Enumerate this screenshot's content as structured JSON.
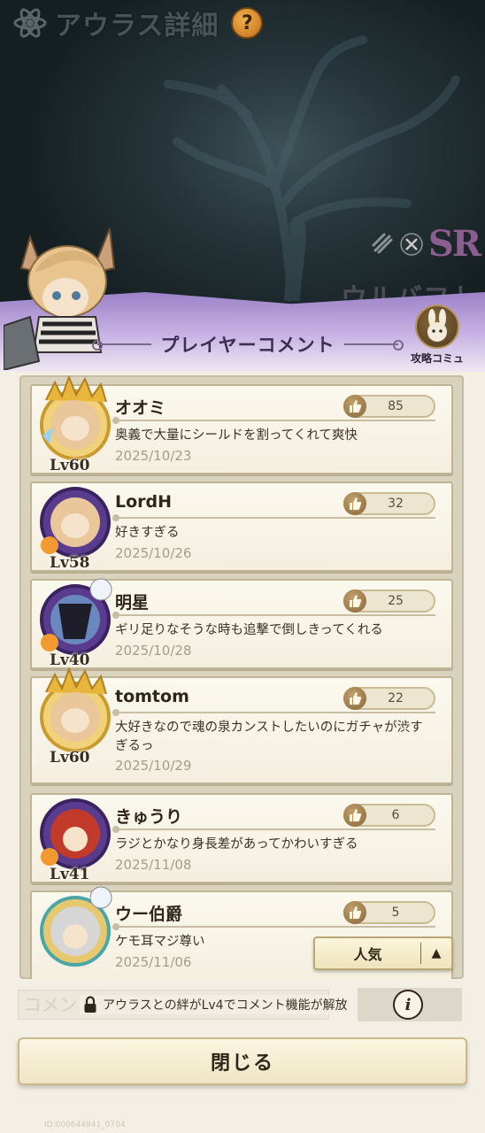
{
  "header": {
    "title": "アウラス詳細",
    "help_label": "?",
    "logo_icon": "atom-emblem-icon"
  },
  "character": {
    "rarity": "SR",
    "name": "ウルバフト",
    "attribute_icons": [
      "wind-attribute-icon",
      "blade-class-icon"
    ]
  },
  "section": {
    "title": "プレイヤーコメント",
    "wiki_label": "攻略コミュ"
  },
  "comments": [
    {
      "name": "オオミ",
      "level": "Lv60",
      "likes": "85",
      "text": "奥義で大量にシールドを割ってくれて爽快",
      "date": "2025/10/23",
      "frame": "gold"
    },
    {
      "name": "LordH",
      "level": "Lv58",
      "likes": "32",
      "text": "好きすぎる",
      "date": "2025/10/26",
      "frame": "purple"
    },
    {
      "name": "明星",
      "level": "Lv40",
      "likes": "25",
      "text": "ギリ足りなそうな時も追撃で倒しきってくれる",
      "date": "2025/10/28",
      "frame": "purple"
    },
    {
      "name": "tomtom",
      "level": "Lv60",
      "likes": "22",
      "text": "大好きなので魂の泉カンストしたいのにガチャが渋すぎるっ",
      "date": "2025/10/29",
      "frame": "gold"
    },
    {
      "name": "きゅうり",
      "level": "Lv41",
      "likes": "6",
      "text": "ラジとかなり身長差があってかわいすぎる",
      "date": "2025/11/08",
      "frame": "purple"
    },
    {
      "name": "ウー伯爵",
      "level": "",
      "likes": "5",
      "text": "ケモ耳マジ尊い",
      "date": "2025/11/06",
      "frame": "teal"
    }
  ],
  "sort": {
    "label": "人気",
    "arrow": "▲"
  },
  "comment_bar": {
    "placeholder": "コメントを入力",
    "locked_message": "アウラスとの絆がLv4でコメント機能が解放",
    "info_label": "i"
  },
  "close_label": "閉じる",
  "footer_id": "ID:000644941_0704",
  "colors": {
    "accent_purple": "#9c82c8",
    "panel_bg": "#f3efe4",
    "card_border": "#bfb596",
    "like_thumb": "#a4824c"
  }
}
